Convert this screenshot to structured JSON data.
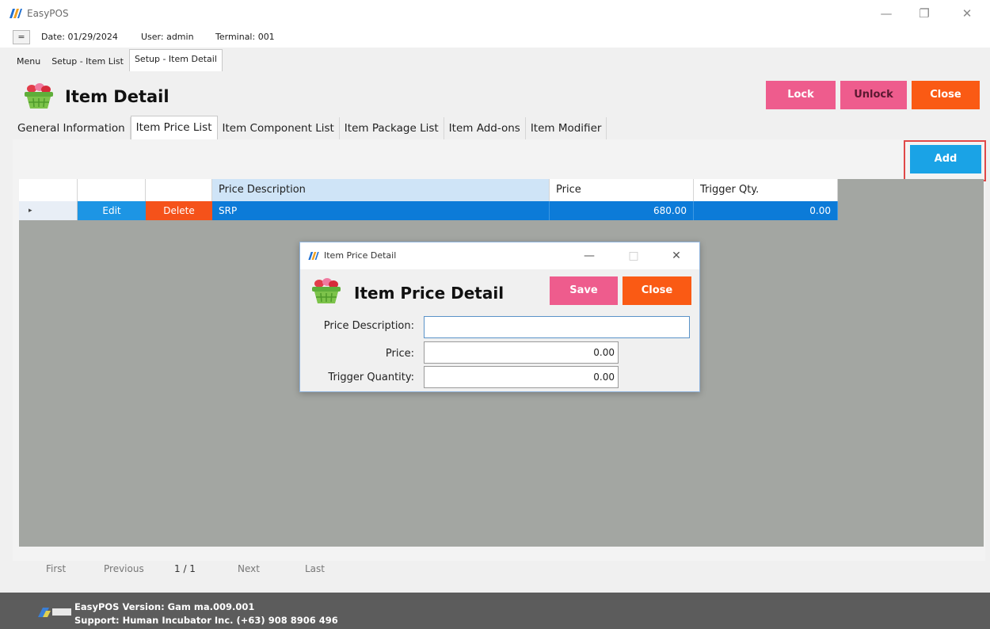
{
  "window": {
    "title": "EasyPOS",
    "controls": [
      "minimize-icon",
      "restore-icon",
      "close-icon"
    ]
  },
  "info_bar": {
    "menu_button_glyph": "=",
    "date": "Date: 01/29/2024",
    "user": "User: admin",
    "terminal": "Terminal: 001"
  },
  "top_tabs": [
    {
      "label": "Menu",
      "active": false
    },
    {
      "label": "Setup - Item List",
      "active": false
    },
    {
      "label": "Setup - Item Detail",
      "active": true
    }
  ],
  "header": {
    "icon": "basket-icon",
    "title": "Item Detail",
    "buttons": {
      "lock": "Lock",
      "unlock": "Unlock",
      "close": "Close"
    }
  },
  "detail_tabs": [
    {
      "label": "General Information",
      "active": false
    },
    {
      "label": "Item Price List",
      "active": true
    },
    {
      "label": "Item Component List",
      "active": false
    },
    {
      "label": "Item Package List",
      "active": false
    },
    {
      "label": "Item Add-ons",
      "active": false
    },
    {
      "label": "Item Modifier",
      "active": false
    }
  ],
  "add_button": "Add",
  "grid": {
    "columns": [
      "",
      "",
      "",
      "Price Description",
      "Price",
      "Trigger Qty."
    ],
    "rows": [
      {
        "row_marker": "▸",
        "edit": "Edit",
        "delete": "Delete",
        "description": "SRP",
        "price": "680.00",
        "trigger_qty": "0.00"
      }
    ]
  },
  "pager": {
    "first": "First",
    "previous": "Previous",
    "page": "1 / 1",
    "next": "Next",
    "last": "Last"
  },
  "footer": {
    "version": "EasyPOS Version: Gam ma.009.001",
    "support": "Support: Human Incubator Inc. (+63) 908 8906 496"
  },
  "dialog": {
    "window_title": "Item Price Detail",
    "heading": "Item Price Detail",
    "save": "Save",
    "close": "Close",
    "fields": [
      {
        "label": "Price Description:",
        "value": ""
      },
      {
        "label": "Price:",
        "value": "0.00"
      },
      {
        "label": "Trigger Quantity:",
        "value": "0.00"
      }
    ]
  },
  "colors": {
    "pink_button": "#ee5c8d",
    "orange_button": "#fa5a14",
    "blue_button": "#1aa3e6",
    "selected_row": "#0c7bd8",
    "grid_background": "#a3a6a2",
    "footer": "#5c5c5c"
  }
}
